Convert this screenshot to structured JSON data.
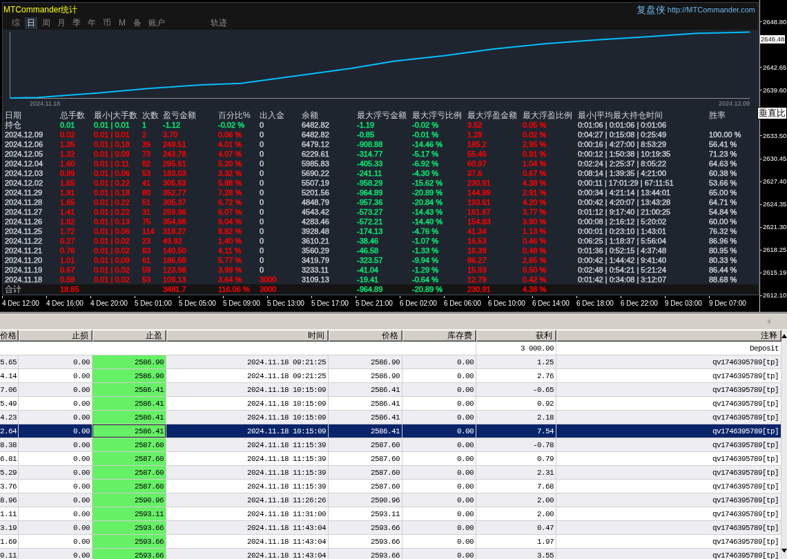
{
  "panel": {
    "title": "MTCommander统计",
    "brand": "复盘侠",
    "website": "http://MTCommander.com",
    "tabs": [
      {
        "label": "综",
        "selected": false
      },
      {
        "label": "日",
        "selected": true
      },
      {
        "label": "周",
        "selected": false
      },
      {
        "label": "月",
        "selected": false
      },
      {
        "label": "季",
        "selected": false
      },
      {
        "label": "年",
        "selected": false
      },
      {
        "label": "币",
        "selected": false
      },
      {
        "label": "M",
        "selected": false
      },
      {
        "label": "备",
        "selected": false
      },
      {
        "label": "账户",
        "selected": false
      },
      {
        "label": "轨迹",
        "selected": false
      }
    ],
    "equity_chart": {
      "start_label": "2024.11.18",
      "end_label": "2024.12.09"
    },
    "stats_table": {
      "columns": [
        "日期",
        "总手数",
        "最小|大手数",
        "次数",
        "盈亏金额",
        "百分比%",
        "出入金",
        "余额",
        "最大浮亏金额",
        "最大浮亏比例",
        "最大浮盈金额",
        "最大浮盈比例",
        "最小|平均最大持仓时间",
        "胜率"
      ],
      "rows": [
        {
          "kind": "open",
          "cells": [
            "持仓",
            {
              "text": "0.01",
              "color": "#00ee76"
            },
            {
              "text": "0.01 | 0.01",
              "color": "#00ee76"
            },
            {
              "text": "1",
              "color": "#00ee76"
            },
            {
              "text": "-1.12",
              "color": "#00ee76"
            },
            {
              "text": "-0.02 %",
              "color": "#00ee76"
            },
            "0",
            "6482.82",
            {
              "text": "-1.19",
              "color": "#00ee76"
            },
            {
              "text": "-0.02 %",
              "color": "#00ee76"
            },
            {
              "text": "3.52",
              "color": "#ff0000"
            },
            {
              "text": "0.05 %",
              "color": "#ff0000"
            },
            "0:01:06 | 0:01:06 | 0:01:06"
          ]
        },
        {
          "kind": "day",
          "cells": [
            "2024.12.09",
            {
              "text": "0.02",
              "color": "#ff0000"
            },
            {
              "text": "0.01 | 0.01",
              "color": "#ff0000"
            },
            {
              "text": "2",
              "color": "#ff0000"
            },
            {
              "text": "3.70",
              "color": "#ff0000"
            },
            {
              "text": "0.06 %",
              "color": "#ff0000"
            },
            "0",
            "6482.82",
            {
              "text": "-0.85",
              "color": "#00ee76"
            },
            {
              "text": "-0.01 %",
              "color": "#00ee76"
            },
            {
              "text": "1.29",
              "color": "#ff0000"
            },
            {
              "text": "0.02 %",
              "color": "#ff0000"
            },
            "0:04:27 | 0:15:08 | 0:25:49",
            "100.00 %"
          ]
        },
        {
          "kind": "day",
          "cells": [
            "2024.12.06",
            {
              "text": "1.35",
              "color": "#ff0000"
            },
            {
              "text": "0.01 | 0.18",
              "color": "#ff0000"
            },
            {
              "text": "39",
              "color": "#ff0000"
            },
            {
              "text": "249.51",
              "color": "#ff0000"
            },
            {
              "text": "4.01 %",
              "color": "#ff0000"
            },
            "0",
            "6479.12",
            {
              "text": "-908.88",
              "color": "#00ee76"
            },
            {
              "text": "-14.46 %",
              "color": "#00ee76"
            },
            {
              "text": "185.2",
              "color": "#ff0000"
            },
            {
              "text": "2.95 %",
              "color": "#ff0000"
            },
            "0:00:16 | 4:27:00 | 8:53:29",
            "56.41 %"
          ]
        },
        {
          "kind": "day",
          "cells": [
            "2024.12.05",
            {
              "text": "1.32",
              "color": "#ff0000"
            },
            {
              "text": "0.01 | 0.09",
              "color": "#ff0000"
            },
            {
              "text": "73",
              "color": "#ff0000"
            },
            {
              "text": "243.78",
              "color": "#ff0000"
            },
            {
              "text": "4.07 %",
              "color": "#ff0000"
            },
            "0",
            "6229.61",
            {
              "text": "-314.77",
              "color": "#00ee76"
            },
            {
              "text": "-5.17 %",
              "color": "#00ee76"
            },
            {
              "text": "55.46",
              "color": "#ff0000"
            },
            {
              "text": "0.91 %",
              "color": "#ff0000"
            },
            "0:00:12 | 1:50:38 | 10:19:35",
            "71.23 %"
          ]
        },
        {
          "kind": "day",
          "cells": [
            "2024.12.04",
            {
              "text": "1.60",
              "color": "#ff0000"
            },
            {
              "text": "0.01 | 0.11",
              "color": "#ff0000"
            },
            {
              "text": "82",
              "color": "#ff0000"
            },
            {
              "text": "295.61",
              "color": "#ff0000"
            },
            {
              "text": "5.20 %",
              "color": "#ff0000"
            },
            "0",
            "5985.83",
            {
              "text": "-405.33",
              "color": "#00ee76"
            },
            {
              "text": "-6.92 %",
              "color": "#00ee76"
            },
            {
              "text": "60.97",
              "color": "#ff0000"
            },
            {
              "text": "1.04 %",
              "color": "#ff0000"
            },
            "0:02:24 | 2:25:37 | 8:05:22",
            "64.63 %"
          ]
        },
        {
          "kind": "day",
          "cells": [
            "2024.12.03",
            {
              "text": "0.99",
              "color": "#ff0000"
            },
            {
              "text": "0.01 | 0.06",
              "color": "#ff0000"
            },
            {
              "text": "53",
              "color": "#ff0000"
            },
            {
              "text": "183.03",
              "color": "#ff0000"
            },
            {
              "text": "3.32 %",
              "color": "#ff0000"
            },
            "0",
            "5690.22",
            {
              "text": "-241.11",
              "color": "#00ee76"
            },
            {
              "text": "-4.30 %",
              "color": "#00ee76"
            },
            {
              "text": "37.6",
              "color": "#ff0000"
            },
            {
              "text": "0.67 %",
              "color": "#ff0000"
            },
            "0:08:14 | 1:39:35 | 4:21:00",
            "60.38 %"
          ]
        },
        {
          "kind": "day",
          "cells": [
            "2024.12.02",
            {
              "text": "1.65",
              "color": "#ff0000"
            },
            {
              "text": "0.01 | 0.22",
              "color": "#ff0000"
            },
            {
              "text": "41",
              "color": "#ff0000"
            },
            {
              "text": "305.63",
              "color": "#ff0000"
            },
            {
              "text": "5.88 %",
              "color": "#ff0000"
            },
            "0",
            "5507.19",
            {
              "text": "-958.29",
              "color": "#00ee76"
            },
            {
              "text": "-15.62 %",
              "color": "#00ee76"
            },
            {
              "text": "230.91",
              "color": "#ff0000"
            },
            {
              "text": "4.38 %",
              "color": "#ff0000"
            },
            "0:00:11 | 17:01:29 | 67:11:51",
            "53.66 %"
          ]
        },
        {
          "kind": "day",
          "cells": [
            "2024.11.29",
            {
              "text": "1.91",
              "color": "#ff0000"
            },
            {
              "text": "0.01 | 0.18",
              "color": "#ff0000"
            },
            {
              "text": "80",
              "color": "#ff0000"
            },
            {
              "text": "352.77",
              "color": "#ff0000"
            },
            {
              "text": "7.28 %",
              "color": "#ff0000"
            },
            "0",
            "5201.56",
            {
              "text": "-964.89",
              "color": "#00ee76"
            },
            {
              "text": "-20.89 %",
              "color": "#00ee76"
            },
            {
              "text": "144.99",
              "color": "#ff0000"
            },
            {
              "text": "2.91 %",
              "color": "#ff0000"
            },
            "0:00:34 | 4:21:14 | 13:44:01",
            "65.00 %"
          ]
        },
        {
          "kind": "day",
          "cells": [
            "2024.11.28",
            {
              "text": "1.65",
              "color": "#ff0000"
            },
            {
              "text": "0.01 | 0.22",
              "color": "#ff0000"
            },
            {
              "text": "51",
              "color": "#ff0000"
            },
            {
              "text": "305.37",
              "color": "#ff0000"
            },
            {
              "text": "6.72 %",
              "color": "#ff0000"
            },
            "0",
            "4848.79",
            {
              "text": "-957.36",
              "color": "#00ee76"
            },
            {
              "text": "-20.84 %",
              "color": "#00ee76"
            },
            {
              "text": "193.61",
              "color": "#ff0000"
            },
            {
              "text": "4.20 %",
              "color": "#ff0000"
            },
            "0:00:42 | 4:20:07 | 13:43:28",
            "64.71 %"
          ]
        },
        {
          "kind": "day",
          "cells": [
            "2024.11.27",
            {
              "text": "1.41",
              "color": "#ff0000"
            },
            {
              "text": "0.01 | 0.22",
              "color": "#ff0000"
            },
            {
              "text": "31",
              "color": "#ff0000"
            },
            {
              "text": "259.96",
              "color": "#ff0000"
            },
            {
              "text": "6.07 %",
              "color": "#ff0000"
            },
            "0",
            "4543.42",
            {
              "text": "-573.27",
              "color": "#00ee76"
            },
            {
              "text": "-14.43 %",
              "color": "#00ee76"
            },
            {
              "text": "161.67",
              "color": "#ff0000"
            },
            {
              "text": "3.77 %",
              "color": "#ff0000"
            },
            "0:01:12 | 9:17:40 | 21:00:25",
            "54.84 %"
          ]
        },
        {
          "kind": "day",
          "cells": [
            "2024.11.26",
            {
              "text": "1.92",
              "color": "#ff0000"
            },
            {
              "text": "0.01 | 0.13",
              "color": "#ff0000"
            },
            {
              "text": "75",
              "color": "#ff0000"
            },
            {
              "text": "354.98",
              "color": "#ff0000"
            },
            {
              "text": "9.04 %",
              "color": "#ff0000"
            },
            "0",
            "4283.46",
            {
              "text": "-572.21",
              "color": "#00ee76"
            },
            {
              "text": "-14.40 %",
              "color": "#00ee76"
            },
            {
              "text": "154.83",
              "color": "#ff0000"
            },
            {
              "text": "3.90 %",
              "color": "#ff0000"
            },
            "0:00:08 | 2:16:12 | 5:20:02",
            "60.00 %"
          ]
        },
        {
          "kind": "day",
          "cells": [
            "2024.11.25",
            {
              "text": "1.72",
              "color": "#ff0000"
            },
            {
              "text": "0.01 | 0.06",
              "color": "#ff0000"
            },
            {
              "text": "114",
              "color": "#ff0000"
            },
            {
              "text": "318.27",
              "color": "#ff0000"
            },
            {
              "text": "8.82 %",
              "color": "#ff0000"
            },
            "0",
            "3928.48",
            {
              "text": "-174.13",
              "color": "#00ee76"
            },
            {
              "text": "-4.76 %",
              "color": "#00ee76"
            },
            {
              "text": "41.34",
              "color": "#ff0000"
            },
            {
              "text": "1.13 %",
              "color": "#ff0000"
            },
            "0:00:01 | 0:23:10 | 1:43:01",
            "76.32 %"
          ]
        },
        {
          "kind": "day",
          "cells": [
            "2024.11.22",
            {
              "text": "0.27",
              "color": "#ff0000"
            },
            {
              "text": "0.01 | 0.02",
              "color": "#ff0000"
            },
            {
              "text": "23",
              "color": "#ff0000"
            },
            {
              "text": "49.92",
              "color": "#ff0000"
            },
            {
              "text": "1.40 %",
              "color": "#ff0000"
            },
            "0",
            "3610.21",
            {
              "text": "-38.46",
              "color": "#00ee76"
            },
            {
              "text": "-1.07 %",
              "color": "#00ee76"
            },
            {
              "text": "16.53",
              "color": "#ff0000"
            },
            {
              "text": "0.46 %",
              "color": "#ff0000"
            },
            "0:06:25 | 1:18:37 | 5:56:04",
            "86.96 %"
          ]
        },
        {
          "kind": "day",
          "cells": [
            "2024.11.21",
            {
              "text": "0.76",
              "color": "#ff0000"
            },
            {
              "text": "0.01 | 0.02",
              "color": "#ff0000"
            },
            {
              "text": "63",
              "color": "#ff0000"
            },
            {
              "text": "140.50",
              "color": "#ff0000"
            },
            {
              "text": "4.11 %",
              "color": "#ff0000"
            },
            "0",
            "3560.29",
            {
              "text": "-46.58",
              "color": "#00ee76"
            },
            {
              "text": "-1.33 %",
              "color": "#00ee76"
            },
            {
              "text": "16.39",
              "color": "#ff0000"
            },
            {
              "text": "0.48 %",
              "color": "#ff0000"
            },
            "0:01:36 | 0:52:15 | 4:37:48",
            "80.95 %"
          ]
        },
        {
          "kind": "day",
          "cells": [
            "2024.11.20",
            {
              "text": "1.01",
              "color": "#ff0000"
            },
            {
              "text": "0.01 | 0.09",
              "color": "#ff0000"
            },
            {
              "text": "61",
              "color": "#ff0000"
            },
            {
              "text": "186.68",
              "color": "#ff0000"
            },
            {
              "text": "5.77 %",
              "color": "#ff0000"
            },
            "0",
            "3419.79",
            {
              "text": "-323.57",
              "color": "#00ee76"
            },
            {
              "text": "-9.94 %",
              "color": "#00ee76"
            },
            {
              "text": "86.27",
              "color": "#ff0000"
            },
            {
              "text": "2.65 %",
              "color": "#ff0000"
            },
            "0:00:42 | 1:44:42 | 9:41:40",
            "80.33 %"
          ]
        },
        {
          "kind": "day",
          "cells": [
            "2024.11.19",
            {
              "text": "0.67",
              "color": "#ff0000"
            },
            {
              "text": "0.01 | 0.02",
              "color": "#ff0000"
            },
            {
              "text": "59",
              "color": "#ff0000"
            },
            {
              "text": "123.98",
              "color": "#ff0000"
            },
            {
              "text": "3.99 %",
              "color": "#ff0000"
            },
            "0",
            "3233.11",
            {
              "text": "-41.04",
              "color": "#00ee76"
            },
            {
              "text": "-1.29 %",
              "color": "#00ee76"
            },
            {
              "text": "15.93",
              "color": "#ff0000"
            },
            {
              "text": "0.50 %",
              "color": "#ff0000"
            },
            "0:02:48 | 0:54:21 | 5:21:24",
            "86.44 %"
          ]
        },
        {
          "kind": "day",
          "cells": [
            "2024.11.18",
            {
              "text": "0.59",
              "color": "#ff0000"
            },
            {
              "text": "0.01 | 0.02",
              "color": "#ff0000"
            },
            {
              "text": "53",
              "color": "#ff0000"
            },
            {
              "text": "109.13",
              "color": "#ff0000"
            },
            {
              "text": "3.64 %",
              "color": "#ff0000"
            },
            {
              "text": "3000",
              "color": "#ff0000"
            },
            "3109.13",
            {
              "text": "-19.41",
              "color": "#00ee76"
            },
            {
              "text": "-0.64 %",
              "color": "#00ee76"
            },
            {
              "text": "12.79",
              "color": "#ff0000"
            },
            {
              "text": "0.42 %",
              "color": "#ff0000"
            },
            "0:01:42 | 0:34:08 | 3:12:07",
            "88.68 %"
          ]
        },
        {
          "kind": "total",
          "cells": [
            "合计",
            {
              "text": "18.85",
              "color": "#ff0000"
            },
            null,
            null,
            {
              "text": "3481.7",
              "color": "#ff0000"
            },
            {
              "text": "116.06 %",
              "color": "#ff0000"
            },
            {
              "text": "3000",
              "color": "#ff0000"
            },
            null,
            {
              "text": "-964.89",
              "color": "#00ee76"
            },
            {
              "text": "-20.89 %",
              "color": "#00ee76"
            },
            {
              "text": "230.91",
              "color": "#ff0000"
            },
            {
              "text": "4.38 %",
              "color": "#ff0000"
            }
          ]
        }
      ]
    }
  },
  "price_axis": [
    {
      "kind": "tick",
      "text": "2648.80"
    },
    {
      "kind": "marker",
      "text": "2646.48"
    },
    {
      "kind": "tick",
      "text": "2642.65"
    },
    {
      "kind": "tick",
      "text": "2639.60"
    },
    {
      "kind": "tooltip",
      "text": "垂直比"
    },
    {
      "kind": "tick",
      "text": "2633.50"
    },
    {
      "kind": "tick",
      "text": "2630.45"
    },
    {
      "kind": "tick",
      "text": "2627.40"
    },
    {
      "kind": "tick",
      "text": "2624.35"
    },
    {
      "kind": "tick",
      "text": "2621.30"
    },
    {
      "kind": "tick",
      "text": "2618.25"
    },
    {
      "kind": "tick",
      "text": "2615.19"
    },
    {
      "kind": "tick",
      "text": "2612.10"
    }
  ],
  "time_axis": [
    "4 Dec 12:00",
    "4 Dec 16:00",
    "4 Dec 20:00",
    "5 Dec 01:00",
    "5 Dec 05:00",
    "5 Dec 09:00",
    "5 Dec 13:00",
    "5 Dec 17:00",
    "5 Dec 21:00",
    "6 Dec 02:00",
    "6 Dec 06:00",
    "6 Dec 10:00",
    "6 Dec 14:00",
    "6 Dec 18:00",
    "6 Dec 22:00",
    "9 Dec 03:00",
    "9 Dec 07:00"
  ],
  "history_table": {
    "columns": [
      "价格",
      "止损",
      "止盈",
      "时间",
      "价格",
      "库存费",
      "获利",
      "注释"
    ],
    "rows": [
      {
        "selected": false,
        "cells": [
          null,
          null,
          null,
          null,
          null,
          null,
          "3 000.00",
          "Deposit"
        ]
      },
      {
        "selected": false,
        "tp_hit": true,
        "cells": [
          "5.65",
          "0.00",
          "2586.90",
          "2024.11.18 09:21:25",
          "2586.90",
          "0.00",
          "1.25",
          "qv1746395789[tp]"
        ]
      },
      {
        "selected": false,
        "tp_hit": true,
        "cells": [
          "4.14",
          "0.00",
          "2586.90",
          "2024.11.18 09:21:25",
          "2586.90",
          "0.00",
          "2.76",
          "qv1746395789[tp]"
        ]
      },
      {
        "selected": false,
        "tp_hit": true,
        "cells": [
          "7.06",
          "0.00",
          "2586.41",
          "2024.11.18 10:15:09",
          "2586.41",
          "0.00",
          "-0.65",
          "qv1746395789[tp]"
        ]
      },
      {
        "selected": false,
        "tp_hit": true,
        "cells": [
          "5.49",
          "0.00",
          "2586.41",
          "2024.11.18 10:15:09",
          "2586.41",
          "0.00",
          "0.92",
          "qv1746395789[tp]"
        ]
      },
      {
        "selected": false,
        "tp_hit": true,
        "cells": [
          "4.23",
          "0.00",
          "2586.41",
          "2024.11.18 10:15:09",
          "2586.41",
          "0.00",
          "2.18",
          "qv1746395789[tp]"
        ]
      },
      {
        "selected": true,
        "tp_hit": true,
        "cells": [
          "2.64",
          "0.00",
          "2586.41",
          "2024.11.18 10:15:09",
          "2586.41",
          "0.00",
          "7.54",
          "qv1746395789[tp]"
        ]
      },
      {
        "selected": false,
        "tp_hit": true,
        "cells": [
          "8.38",
          "0.00",
          "2587.60",
          "2024.11.18 11:15:39",
          "2587.60",
          "0.00",
          "-0.78",
          "qv1746395789[tp]"
        ]
      },
      {
        "selected": false,
        "tp_hit": true,
        "cells": [
          "6.81",
          "0.00",
          "2587.60",
          "2024.11.18 11:15:39",
          "2587.60",
          "0.00",
          "0.79",
          "qv1746395789[tp]"
        ]
      },
      {
        "selected": false,
        "tp_hit": true,
        "cells": [
          "5.29",
          "0.00",
          "2587.60",
          "2024.11.18 11:15:39",
          "2587.60",
          "0.00",
          "2.31",
          "qv1746395789[tp]"
        ]
      },
      {
        "selected": false,
        "tp_hit": true,
        "cells": [
          "3.76",
          "0.00",
          "2587.60",
          "2024.11.18 11:15:39",
          "2587.60",
          "0.00",
          "7.68",
          "qv1746395789[tp]"
        ]
      },
      {
        "selected": false,
        "tp_hit": true,
        "cells": [
          "8.96",
          "0.00",
          "2590.96",
          "2024.11.18 11:26:26",
          "2590.96",
          "0.00",
          "2.00",
          "qv1746395789[tp]"
        ]
      },
      {
        "selected": false,
        "tp_hit": true,
        "cells": [
          "1.11",
          "0.00",
          "2593.11",
          "2024.11.18 11:31:00",
          "2593.11",
          "0.00",
          "2.00",
          "qv1746395789[tp]"
        ]
      },
      {
        "selected": false,
        "tp_hit": true,
        "cells": [
          "3.19",
          "0.00",
          "2593.66",
          "2024.11.18 11:43:04",
          "2593.66",
          "0.00",
          "0.47",
          "qv1746395789[tp]"
        ]
      },
      {
        "selected": false,
        "tp_hit": true,
        "cells": [
          "1.69",
          "0.00",
          "2593.66",
          "2024.11.18 11:43:04",
          "2593.66",
          "0.00",
          "1.97",
          "qv1746395789[tp]"
        ]
      },
      {
        "selected": false,
        "tp_hit": true,
        "cells": [
          "0.11",
          "0.00",
          "2593.66",
          "2024.11.18 11:43:04",
          "2593.66",
          "0.00",
          "3.55",
          "qv1746395789[tp]"
        ]
      }
    ]
  }
}
